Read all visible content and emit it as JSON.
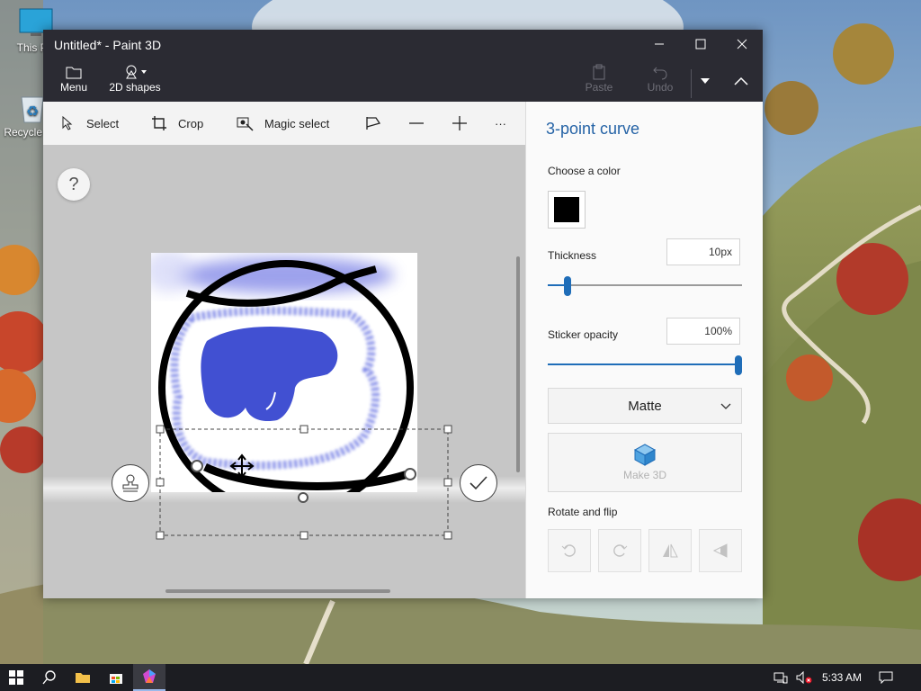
{
  "desktop": {
    "icons": [
      {
        "label": "This PC",
        "icon": "monitor-icon"
      },
      {
        "label": "Recycle Bin",
        "icon": "recycle-bin-icon"
      }
    ]
  },
  "window": {
    "title": "Untitled* - Paint 3D",
    "controls": {
      "minimize": "minimize-icon",
      "maximize": "maximize-icon",
      "close": "close-icon"
    }
  },
  "ribbon": {
    "menu_label": "Menu",
    "shapes_label": "2D shapes",
    "paste_label": "Paste",
    "undo_label": "Undo"
  },
  "toolbar": {
    "select_label": "Select",
    "crop_label": "Crop",
    "magic_select_label": "Magic select",
    "more_label": "···"
  },
  "canvas": {
    "help_label": "?",
    "brush_color": "#3f4fd4",
    "stroke_color": "#000000"
  },
  "panel": {
    "title": "3-point curve",
    "color_label": "Choose a color",
    "selected_color": "#000000",
    "thickness_label": "Thickness",
    "thickness_value": "10px",
    "thickness_fraction": 0.1,
    "opacity_label": "Sticker opacity",
    "opacity_value": "100%",
    "opacity_fraction": 1.0,
    "finish_selected": "Matte",
    "make3d_label": "Make 3D",
    "rotate_label": "Rotate and flip"
  },
  "taskbar": {
    "time": "5:33 AM",
    "accent": "#9bb9ea"
  }
}
